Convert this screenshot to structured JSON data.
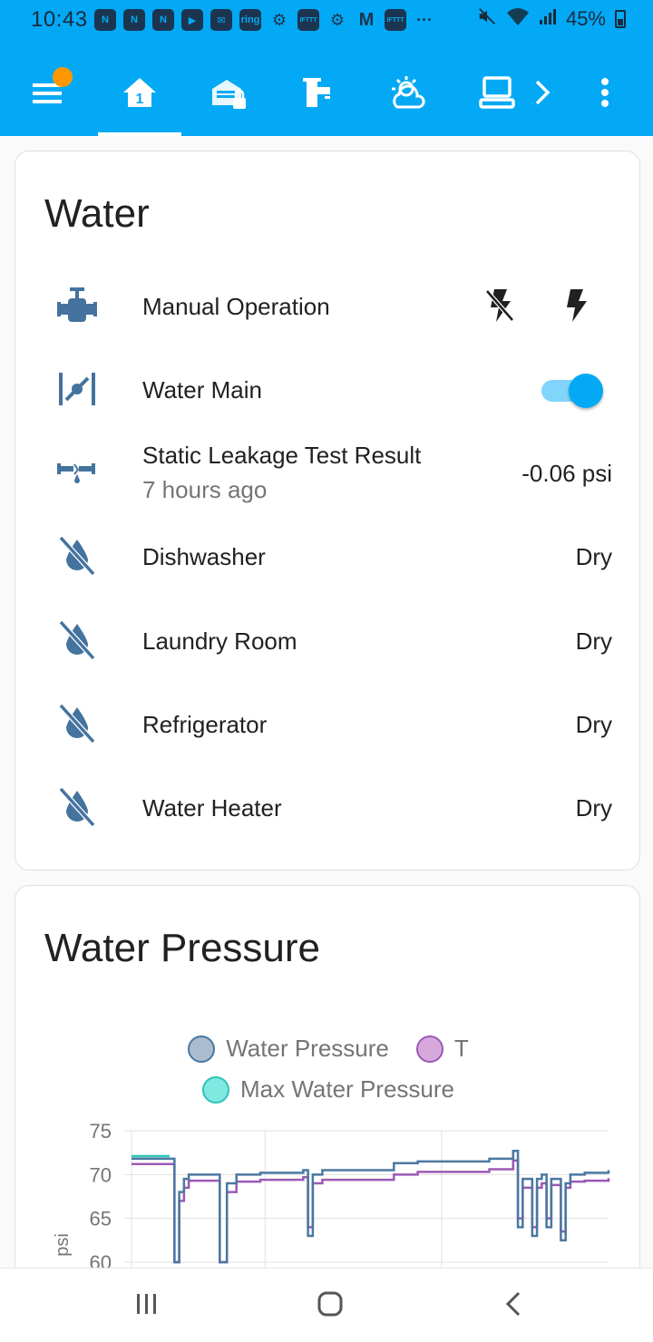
{
  "status_bar": {
    "time": "10:43",
    "notification_icons": [
      "nest-icon",
      "nest-icon",
      "nest-icon",
      "youtube-icon",
      "mail-icon",
      "ring-icon",
      "settings-icon",
      "ifttt-icon",
      "settings-icon",
      "gmail-icon",
      "ifttt-icon"
    ],
    "ring_label": "ring",
    "ifttt_label": "IFTTT",
    "more": "···",
    "battery": "45%"
  },
  "header": {
    "tabs": [
      {
        "icon": "menu-icon",
        "has_badge": true
      },
      {
        "icon": "home-icon",
        "active": true
      },
      {
        "icon": "garage-lock-icon"
      },
      {
        "icon": "faucet-icon"
      },
      {
        "icon": "weather-partly-cloudy-icon"
      },
      {
        "icon": "laptop-icon"
      },
      {
        "icon": "chevron-right-icon"
      },
      {
        "icon": "overflow-menu-icon"
      }
    ]
  },
  "water_card": {
    "title": "Water",
    "rows": [
      {
        "icon": "valve-icon",
        "name": "Manual Operation",
        "actions": [
          "flash-off-icon",
          "flash-icon"
        ]
      },
      {
        "icon": "valve-open-icon",
        "name": "Water Main",
        "toggle": true
      },
      {
        "icon": "pipe-leak-icon",
        "name": "Static Leakage Test Result",
        "secondary": "7 hours ago",
        "value": "-0.06 psi"
      },
      {
        "icon": "water-off-icon",
        "name": "Dishwasher",
        "value": "Dry"
      },
      {
        "icon": "water-off-icon",
        "name": "Laundry Room",
        "value": "Dry"
      },
      {
        "icon": "water-off-icon",
        "name": "Refrigerator",
        "value": "Dry"
      },
      {
        "icon": "water-off-icon",
        "name": "Water Heater",
        "value": "Dry"
      }
    ]
  },
  "pressure_card": {
    "title": "Water Pressure"
  },
  "chart_data": {
    "type": "line",
    "title": "",
    "xlabel": "",
    "ylabel": "psi",
    "ylim": [
      60,
      75
    ],
    "yticks": [
      75,
      70,
      65,
      60
    ],
    "grid": true,
    "legend_position": "top",
    "series": [
      {
        "name": "Water Pressure",
        "color": "#4a78a0",
        "fill": "#a9bcd0",
        "x": [
          0,
          0.08,
          0.09,
          0.095,
          0.1,
          0.11,
          0.12,
          0.15,
          0.18,
          0.185,
          0.19,
          0.2,
          0.22,
          0.27,
          0.36,
          0.37,
          0.38,
          0.4,
          0.55,
          0.6,
          0.75,
          0.8,
          0.81,
          0.82,
          0.84,
          0.85,
          0.86,
          0.87,
          0.88,
          0.9,
          0.91,
          0.92,
          0.95,
          1.0
        ],
        "y": [
          71.8,
          71.8,
          60,
          60,
          68,
          69.5,
          70,
          70,
          70,
          60,
          60,
          69,
          70,
          70.2,
          70.5,
          63,
          70,
          70.5,
          71.3,
          71.5,
          71.8,
          72.7,
          64,
          69.5,
          63,
          69.5,
          70,
          64,
          69.5,
          62.5,
          69,
          70,
          70.2,
          70.5
        ]
      },
      {
        "name": "T",
        "color": "#9b59b6",
        "fill": "#d7a8dc",
        "x": [
          0,
          0.08,
          0.09,
          0.095,
          0.1,
          0.11,
          0.12,
          0.15,
          0.18,
          0.185,
          0.19,
          0.2,
          0.22,
          0.27,
          0.36,
          0.37,
          0.38,
          0.4,
          0.55,
          0.6,
          0.75,
          0.8,
          0.81,
          0.82,
          0.84,
          0.85,
          0.86,
          0.87,
          0.88,
          0.9,
          0.91,
          0.92,
          0.95,
          1.0
        ],
        "y": [
          71.2,
          71.2,
          60,
          60,
          67,
          68.5,
          69.3,
          69.3,
          69.3,
          60,
          60,
          68,
          69.2,
          69.4,
          69.7,
          64,
          69,
          69.4,
          70,
          70.3,
          70.6,
          71.6,
          65,
          68.5,
          64,
          68.5,
          69,
          65,
          68.8,
          63.5,
          68.5,
          69.2,
          69.3,
          69.6
        ]
      },
      {
        "name": "Max Water Pressure",
        "color": "#2ec4b6",
        "fill": "#7fe8e1",
        "x": [
          0,
          0.08
        ],
        "y": [
          72.1,
          72.1
        ]
      }
    ]
  },
  "navbar": {
    "buttons": [
      "recent-apps-icon",
      "home-button-icon",
      "back-icon"
    ]
  }
}
